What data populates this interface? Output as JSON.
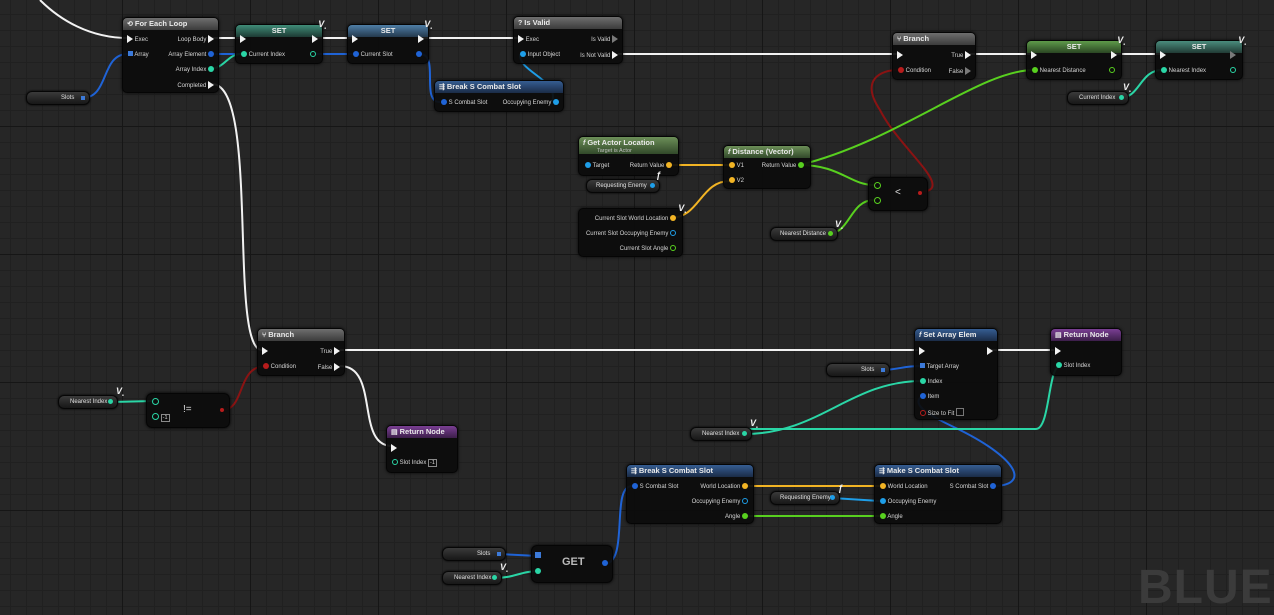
{
  "colors": {
    "exec_wire": "#f2f2f2",
    "struct_wire": "#1f63d6",
    "int_wire": "#2ad6a6",
    "bool_wire": "#8a1313",
    "vector_wire": "#f2b424",
    "float_wire": "#58d01f",
    "object_wire": "#1e9ee8",
    "grid_bg": "#262626"
  },
  "nodes": {
    "for_each": {
      "title": "For Each Loop",
      "exec": "Exec",
      "loop_body": "Loop Body",
      "array": "Array",
      "array_element": "Array Element",
      "array_index": "Array Index",
      "completed": "Completed"
    },
    "set1": {
      "title": "SET",
      "pin": "Current Index"
    },
    "set2": {
      "title": "SET",
      "pin": "Current Slot"
    },
    "is_valid": {
      "title": "Is Valid",
      "exec": "Exec",
      "is_valid": "Is Valid",
      "input": "Input Object",
      "is_not_valid": "Is Not Valid"
    },
    "break1": {
      "title": "Break S Combat Slot",
      "in": "S Combat Slot",
      "out": "Occupying Enemy"
    },
    "branch1": {
      "title": "Branch",
      "condition": "Condition",
      "true": "True",
      "false": "False"
    },
    "set3": {
      "title": "SET",
      "pin": "Nearest Distance"
    },
    "set4": {
      "title": "SET",
      "pin": "Nearest Index"
    },
    "get_actor_location": {
      "title": "Get Actor Location",
      "subtitle": "Target is Actor",
      "target": "Target",
      "ret": "Return Value"
    },
    "distance": {
      "title": "Distance (Vector)",
      "v1": "V1",
      "v2": "V2",
      "ret": "Return Value"
    },
    "less": {
      "symbol": "<"
    },
    "current_slot_break": {
      "world_location": "Current Slot World Location",
      "occupying": "Current Slot Occupying Enemy",
      "angle": "Current Slot Angle"
    },
    "branch2": {
      "title": "Branch",
      "condition": "Condition",
      "true": "True",
      "false": "False"
    },
    "not_equal": {
      "symbol": "!=",
      "value": "-1"
    },
    "return1": {
      "title": "Return Node",
      "pin": "Slot Index",
      "value": "-1"
    },
    "set_array_elem": {
      "title": "Set Array Elem",
      "target_array": "Target Array",
      "index": "Index",
      "item": "Item",
      "size_to_fit": "Size to Fit"
    },
    "return2": {
      "title": "Return Node",
      "pin": "Slot Index"
    },
    "break2": {
      "title": "Break S Combat Slot",
      "in": "S Combat Slot",
      "world_location": "World Location",
      "occupying": "Occupying Enemy",
      "angle": "Angle"
    },
    "make": {
      "title": "Make S Combat Slot",
      "world_location": "World Location",
      "out": "S Combat Slot",
      "occupying": "Occupying Enemy",
      "angle": "Angle"
    },
    "get": {
      "title": "GET"
    }
  },
  "vars": {
    "slots": "Slots",
    "current_index": "Current Index",
    "requesting_enemy": "Requesting Enemy",
    "nearest_distance": "Nearest Distance",
    "nearest_index": "Nearest Index"
  },
  "watermark": "BLUE"
}
